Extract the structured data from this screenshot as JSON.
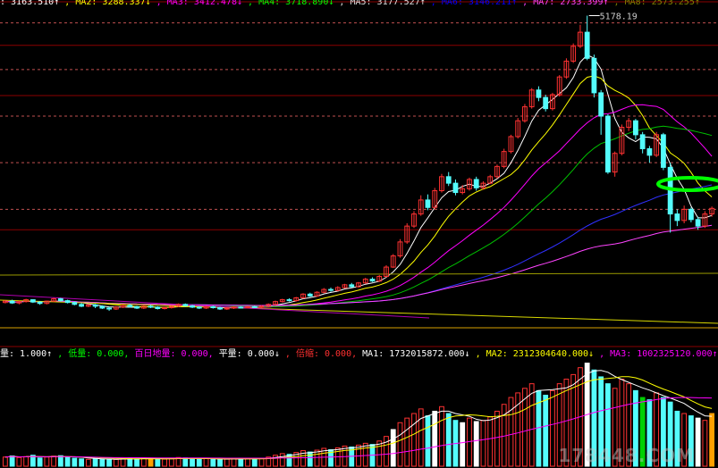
{
  "price_panel": {
    "legend": [
      {
        "text": ": 3163.510",
        "arrow": "↑",
        "color": "#ffffff"
      },
      {
        "text": ", MA2: 3288.337",
        "arrow": "↓",
        "color": "#ffff00"
      },
      {
        "text": ", MA3: 3412.478",
        "arrow": "↓",
        "color": "#ff00ff"
      },
      {
        "text": ", MA4: 3718.890",
        "arrow": "↓",
        "color": "#00ff00"
      },
      {
        "text": ", MA5: 3177.527",
        "arrow": "↑",
        "color": "#e0e0e0"
      },
      {
        "text": ", MA6: 3146.211",
        "arrow": "↑",
        "color": "#0000ff"
      },
      {
        "text": ", MA7: 2733.399",
        "arrow": "↑",
        "color": "#ff44ff"
      },
      {
        "text": ", MA8: 2573.255",
        "arrow": "↑",
        "color": "#808000"
      }
    ],
    "peak_label": "5178.19"
  },
  "volume_panel": {
    "legend": [
      {
        "text": "量: 1.000",
        "arrow": "↑",
        "color": "#ffffff"
      },
      {
        "text": ", 低量: 0.000",
        "arrow": ",",
        "color": "#00ff00"
      },
      {
        "text": " 百日地量: 0.000",
        "arrow": ",",
        "color": "#ff00ff"
      },
      {
        "text": " 平量: 0.000",
        "arrow": "↓",
        "color": "#ffffff"
      },
      {
        "text": ", 倍缩: 0.000",
        "arrow": ",",
        "color": "#ff3030"
      },
      {
        "text": " MA1: 1732015872.000",
        "arrow": "↓",
        "color": "#ffffff"
      },
      {
        "text": ", MA2: 2312304640.000",
        "arrow": "↓",
        "color": "#ffff00"
      },
      {
        "text": ", MA3: 1002325120.000",
        "arrow": "↑",
        "color": "#ff00ff"
      }
    ]
  },
  "watermark": "178448.COM",
  "colors": {
    "up": "#ff3232",
    "down": "#54fcfc",
    "grid": "#8b0000",
    "background": "#000000"
  },
  "chart_data": {
    "type": "candlestick",
    "peak_value": 5178.19,
    "ylim": [
      1800,
      5250
    ],
    "candles": [
      [
        2100,
        2115,
        2125,
        2090
      ],
      [
        2115,
        2095,
        2130,
        2085
      ],
      [
        2095,
        2110,
        2120,
        2080
      ],
      [
        2110,
        2130,
        2140,
        2100
      ],
      [
        2130,
        2105,
        2135,
        2095
      ],
      [
        2105,
        2090,
        2115,
        2075
      ],
      [
        2090,
        2115,
        2120,
        2080
      ],
      [
        2115,
        2140,
        2150,
        2105
      ],
      [
        2140,
        2120,
        2150,
        2110
      ],
      [
        2120,
        2100,
        2130,
        2090
      ],
      [
        2100,
        2080,
        2110,
        2070
      ],
      [
        2080,
        2060,
        2095,
        2050
      ],
      [
        2060,
        2075,
        2085,
        2050
      ],
      [
        2075,
        2060,
        2085,
        2040
      ],
      [
        2060,
        2040,
        2070,
        2030
      ],
      [
        2040,
        2030,
        2055,
        2010
      ],
      [
        2030,
        2050,
        2060,
        2020
      ],
      [
        2050,
        2070,
        2080,
        2040
      ],
      [
        2070,
        2055,
        2085,
        2045
      ],
      [
        2055,
        2040,
        2065,
        2030
      ],
      [
        2040,
        2060,
        2070,
        2030
      ],
      [
        2060,
        2050,
        2075,
        2040
      ],
      [
        2050,
        2035,
        2060,
        2025
      ],
      [
        2035,
        2045,
        2055,
        2025
      ],
      [
        2045,
        2060,
        2070,
        2035
      ],
      [
        2060,
        2080,
        2090,
        2050
      ],
      [
        2080,
        2065,
        2090,
        2055
      ],
      [
        2065,
        2050,
        2075,
        2040
      ],
      [
        2050,
        2040,
        2060,
        2030
      ],
      [
        2040,
        2055,
        2065,
        2030
      ],
      [
        2055,
        2045,
        2065,
        2035
      ],
      [
        2045,
        2030,
        2055,
        2020
      ],
      [
        2030,
        2040,
        2050,
        2020
      ],
      [
        2040,
        2050,
        2060,
        2030
      ],
      [
        2050,
        2045,
        2060,
        2035
      ],
      [
        2045,
        2055,
        2065,
        2035
      ],
      [
        2055,
        2050,
        2065,
        2040
      ],
      [
        2050,
        2060,
        2070,
        2040
      ],
      [
        2060,
        2080,
        2090,
        2050
      ],
      [
        2080,
        2110,
        2120,
        2070
      ],
      [
        2110,
        2130,
        2140,
        2100
      ],
      [
        2130,
        2120,
        2145,
        2110
      ],
      [
        2120,
        2150,
        2160,
        2110
      ],
      [
        2150,
        2190,
        2200,
        2140
      ],
      [
        2190,
        2170,
        2205,
        2160
      ],
      [
        2170,
        2210,
        2220,
        2160
      ],
      [
        2210,
        2240,
        2255,
        2200
      ],
      [
        2240,
        2230,
        2260,
        2215
      ],
      [
        2230,
        2260,
        2275,
        2220
      ],
      [
        2260,
        2290,
        2300,
        2250
      ],
      [
        2290,
        2270,
        2310,
        2260
      ],
      [
        2270,
        2310,
        2320,
        2260
      ],
      [
        2310,
        2350,
        2365,
        2300
      ],
      [
        2350,
        2330,
        2370,
        2320
      ],
      [
        2330,
        2380,
        2395,
        2320
      ],
      [
        2380,
        2480,
        2500,
        2370
      ],
      [
        2480,
        2600,
        2620,
        2470
      ],
      [
        2600,
        2750,
        2780,
        2580
      ],
      [
        2750,
        2920,
        2950,
        2730
      ],
      [
        2920,
        3050,
        3080,
        2900
      ],
      [
        3050,
        3200,
        3250,
        3030
      ],
      [
        3200,
        3120,
        3260,
        3090
      ],
      [
        3120,
        3300,
        3330,
        3100
      ],
      [
        3300,
        3450,
        3480,
        3280
      ],
      [
        3450,
        3380,
        3500,
        3350
      ],
      [
        3380,
        3280,
        3420,
        3250
      ],
      [
        3280,
        3320,
        3360,
        3260
      ],
      [
        3320,
        3420,
        3440,
        3300
      ],
      [
        3420,
        3330,
        3450,
        3300
      ],
      [
        3330,
        3380,
        3400,
        3310
      ],
      [
        3380,
        3450,
        3470,
        3370
      ],
      [
        3450,
        3560,
        3580,
        3430
      ],
      [
        3560,
        3720,
        3750,
        3540
      ],
      [
        3720,
        3880,
        3900,
        3700
      ],
      [
        3880,
        4050,
        4080,
        3860
      ],
      [
        4050,
        4200,
        4230,
        4030
      ],
      [
        4200,
        4380,
        4400,
        4180
      ],
      [
        4380,
        4300,
        4420,
        4260
      ],
      [
        4300,
        4180,
        4330,
        4150
      ],
      [
        4180,
        4330,
        4350,
        4160
      ],
      [
        4330,
        4520,
        4540,
        4310
      ],
      [
        4520,
        4690,
        4720,
        4500
      ],
      [
        4690,
        4850,
        4880,
        4670
      ],
      [
        4850,
        5000,
        5080,
        4830
      ],
      [
        5000,
        4720,
        5178,
        4700
      ],
      [
        4720,
        4350,
        4760,
        4300
      ],
      [
        4350,
        4100,
        4380,
        3900
      ],
      [
        4100,
        3500,
        4120,
        3480
      ],
      [
        3500,
        3700,
        3720,
        3450
      ],
      [
        3700,
        3980,
        4010,
        3680
      ],
      [
        3980,
        4050,
        4080,
        3940
      ],
      [
        4050,
        3900,
        4070,
        3850
      ],
      [
        3900,
        3750,
        3930,
        3700
      ],
      [
        3750,
        3680,
        3780,
        3600
      ],
      [
        3680,
        3900,
        3930,
        3660
      ],
      [
        3900,
        3550,
        3920,
        3520
      ],
      [
        3550,
        3050,
        3600,
        2850
      ],
      [
        3050,
        2980,
        3100,
        2920
      ],
      [
        2980,
        3100,
        3140,
        2950
      ],
      [
        3100,
        2990,
        3120,
        2960
      ],
      [
        2990,
        2920,
        3020,
        2880
      ],
      [
        2920,
        3050,
        3080,
        2900
      ],
      [
        3050,
        3110,
        3130,
        3020
      ]
    ],
    "volume": [
      40,
      45,
      38,
      42,
      48,
      36,
      40,
      44,
      46,
      39,
      35,
      32,
      30,
      34,
      31,
      28,
      30,
      33,
      35,
      32,
      36,
      34,
      30,
      31,
      33,
      38,
      36,
      32,
      30,
      34,
      32,
      29,
      31,
      33,
      32,
      34,
      33,
      35,
      40,
      48,
      55,
      52,
      60,
      68,
      62,
      70,
      78,
      72,
      80,
      88,
      84,
      92,
      100,
      95,
      110,
      130,
      160,
      190,
      210,
      230,
      250,
      220,
      240,
      260,
      230,
      200,
      190,
      210,
      195,
      200,
      215,
      240,
      270,
      300,
      320,
      340,
      360,
      330,
      310,
      330,
      360,
      380,
      400,
      430,
      450,
      420,
      390,
      360,
      340,
      380,
      360,
      330,
      300,
      290,
      320,
      300,
      280,
      240,
      230,
      220,
      210,
      200,
      230
    ]
  }
}
